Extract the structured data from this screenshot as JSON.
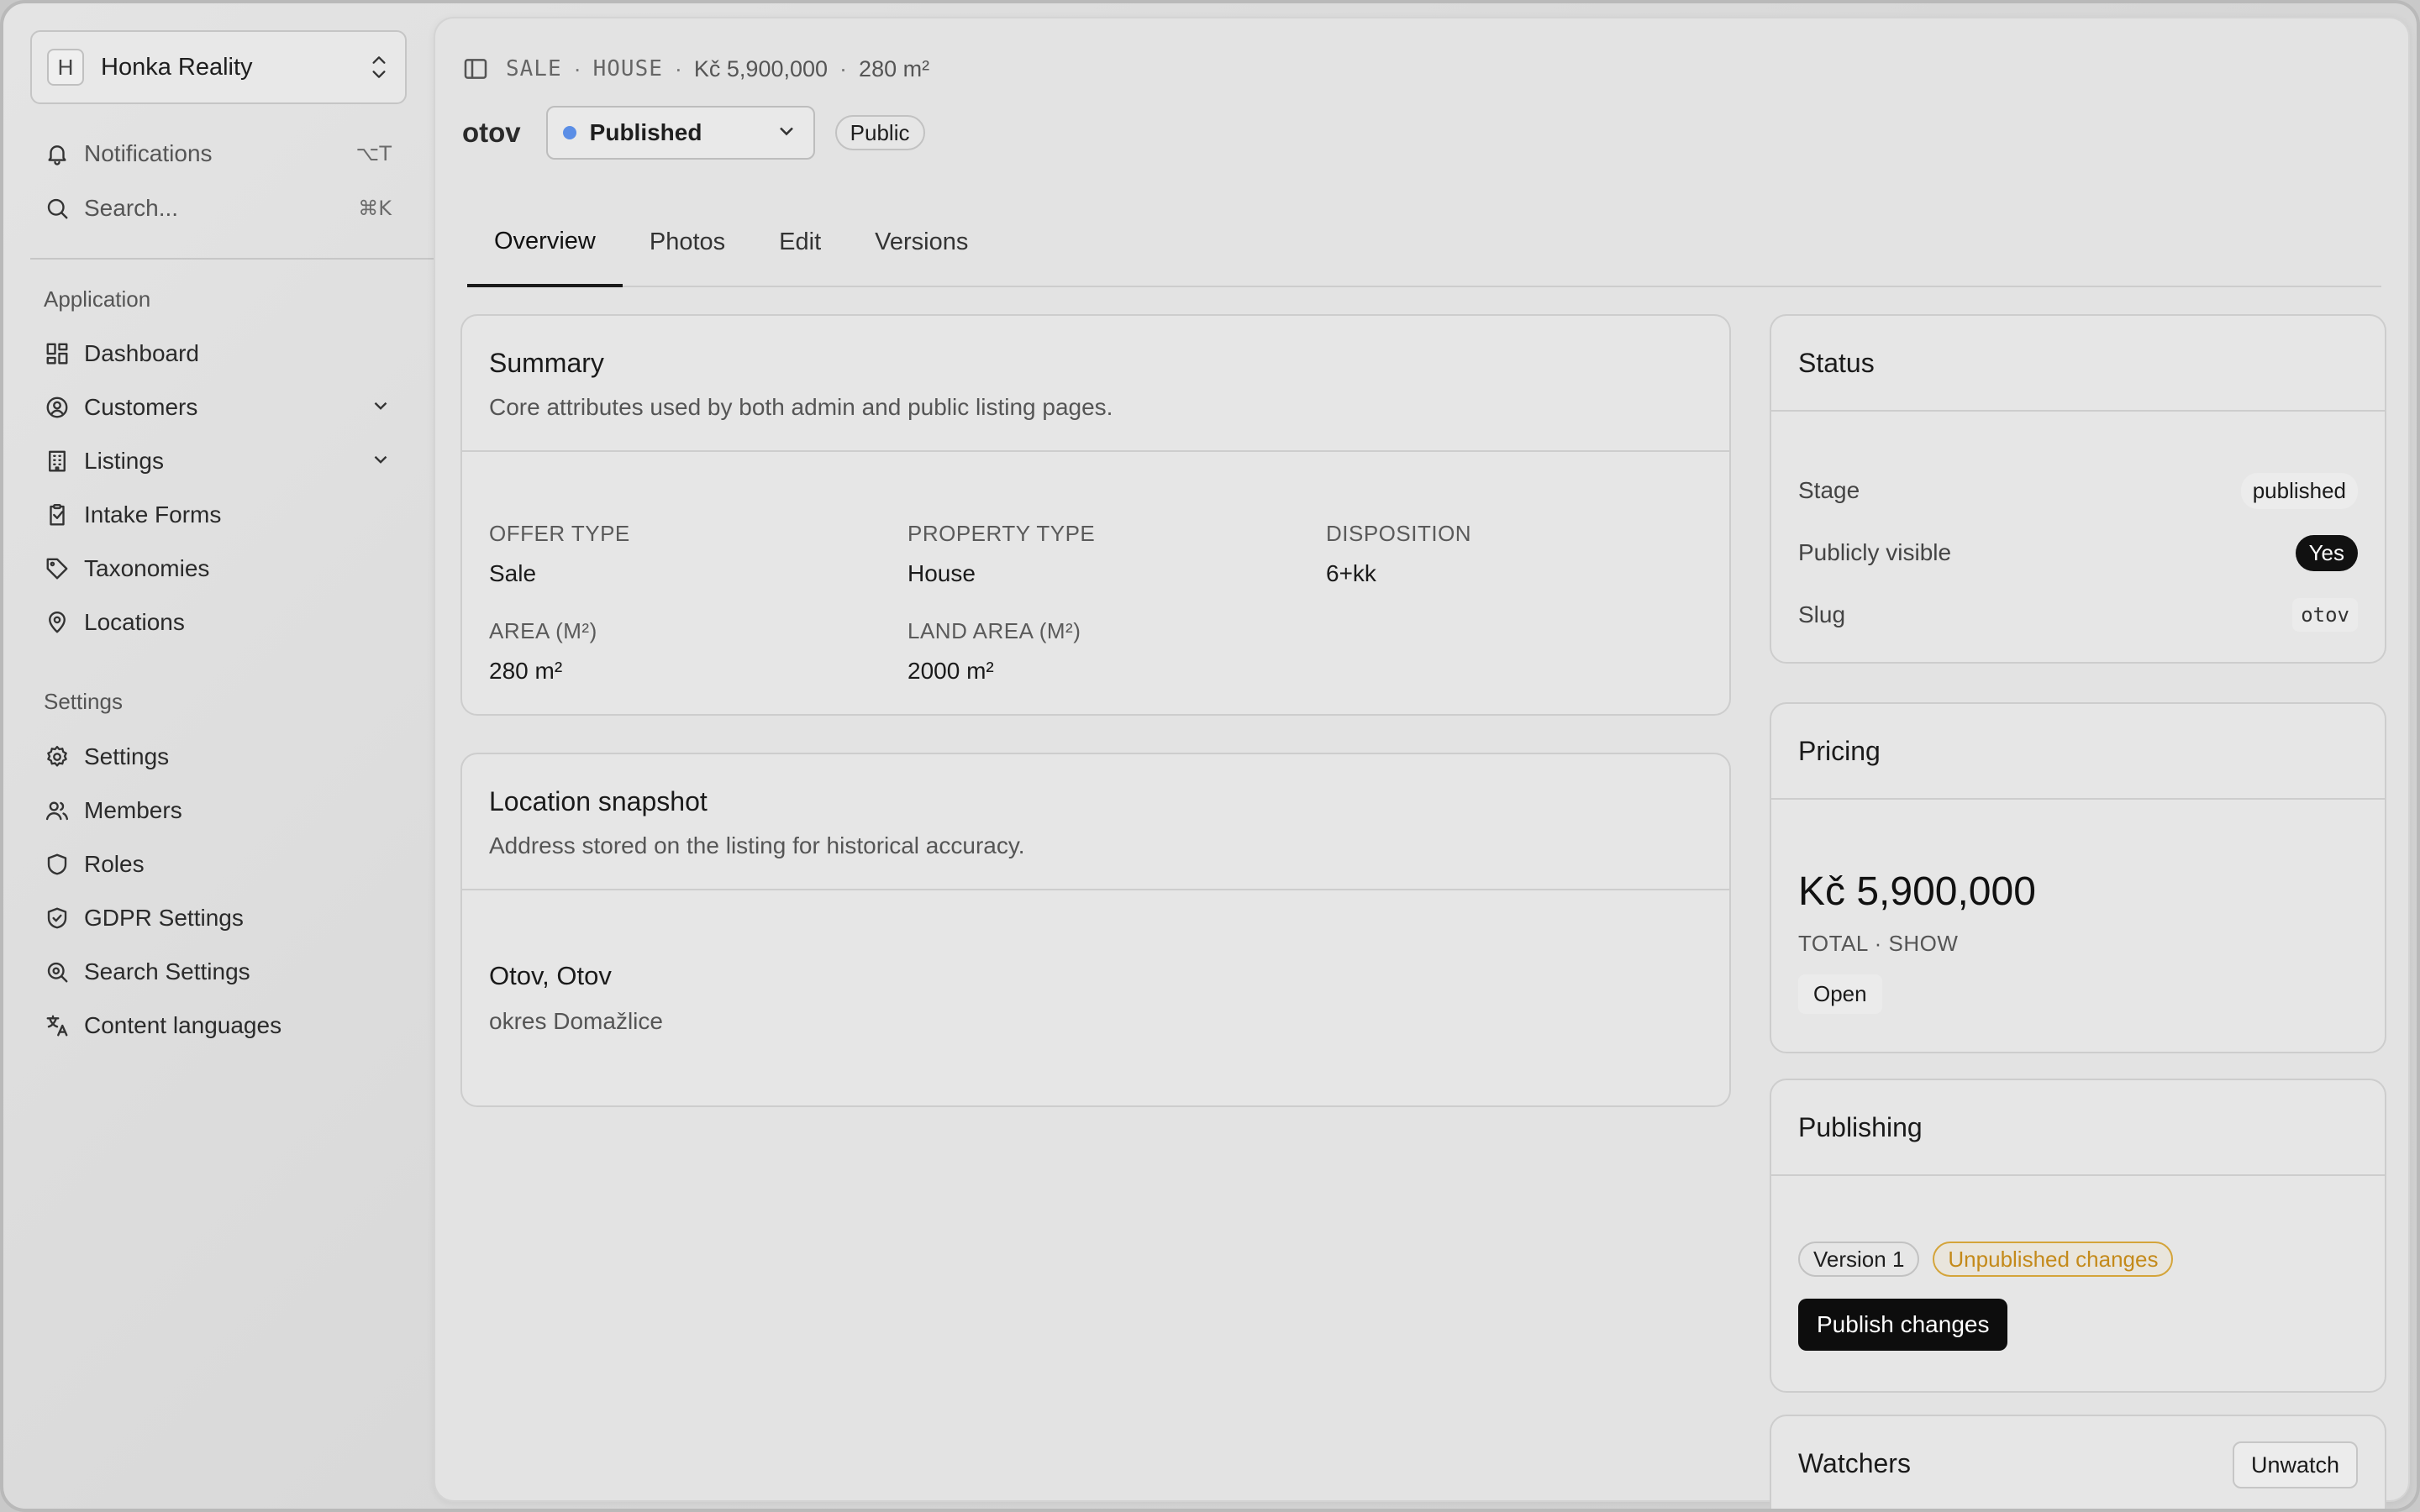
{
  "org": {
    "initial": "H",
    "name": "Honka Reality"
  },
  "top_nav": [
    {
      "label": "Notifications",
      "shortcut": "⌥T",
      "icon": "bell-icon"
    },
    {
      "label": "Search...",
      "shortcut": "⌘K",
      "icon": "search-icon"
    }
  ],
  "sections": {
    "application": "Application",
    "settings": "Settings"
  },
  "application_nav": [
    {
      "label": "Dashboard",
      "icon": "dashboard-icon"
    },
    {
      "label": "Customers",
      "icon": "user-circle-icon"
    },
    {
      "label": "Listings",
      "icon": "building-icon"
    },
    {
      "label": "Intake Forms",
      "icon": "clipboard-icon"
    },
    {
      "label": "Taxonomies",
      "icon": "tag-icon"
    },
    {
      "label": "Locations",
      "icon": "map-pin-icon"
    }
  ],
  "settings_nav": [
    {
      "label": "Settings",
      "icon": "gear-icon"
    },
    {
      "label": "Members",
      "icon": "users-icon"
    },
    {
      "label": "Roles",
      "icon": "shield-icon"
    },
    {
      "label": "GDPR Settings",
      "icon": "shield-check-icon"
    },
    {
      "label": "Search Settings",
      "icon": "search-settings-icon"
    },
    {
      "label": "Content languages",
      "icon": "translate-icon"
    }
  ],
  "breadcrumb": {
    "offer": "SALE",
    "property": "HOUSE",
    "price": "Kč 5,900,000",
    "area": "280 m²",
    "separator": "·"
  },
  "header": {
    "title": "otov",
    "status": "Published",
    "visibility": "Public"
  },
  "tabs": [
    "Overview",
    "Photos",
    "Edit",
    "Versions"
  ],
  "summary": {
    "title": "Summary",
    "description": "Core attributes used by both admin and public listing pages.",
    "fields": [
      {
        "label": "OFFER TYPE",
        "value": "Sale"
      },
      {
        "label": "PROPERTY TYPE",
        "value": "House"
      },
      {
        "label": "DISPOSITION",
        "value": "6+kk"
      },
      {
        "label": "AREA (M²)",
        "value": "280 m²"
      },
      {
        "label": "LAND AREA (M²)",
        "value": "2000 m²"
      }
    ]
  },
  "location": {
    "title": "Location snapshot",
    "description": "Address stored on the listing for historical accuracy.",
    "address": "Otov, Otov",
    "district": "okres Domažlice"
  },
  "status_card": {
    "title": "Status",
    "rows": [
      {
        "key": "Stage",
        "value": "published"
      },
      {
        "key": "Publicly visible",
        "value": "Yes"
      },
      {
        "key": "Slug",
        "value": "otov"
      }
    ]
  },
  "pricing": {
    "title": "Pricing",
    "price": "Kč 5,900,000",
    "subtitle": "TOTAL · SHOW",
    "state": "Open"
  },
  "publishing": {
    "title": "Publishing",
    "version": "Version 1",
    "changes": "Unpublished changes",
    "button": "Publish changes"
  },
  "watchers": {
    "title": "Watchers",
    "button": "Unwatch"
  },
  "colors": {
    "status_dot": "#5b8ee6",
    "warning": "#c48a1a",
    "primary_button": "#0d0d0d"
  }
}
